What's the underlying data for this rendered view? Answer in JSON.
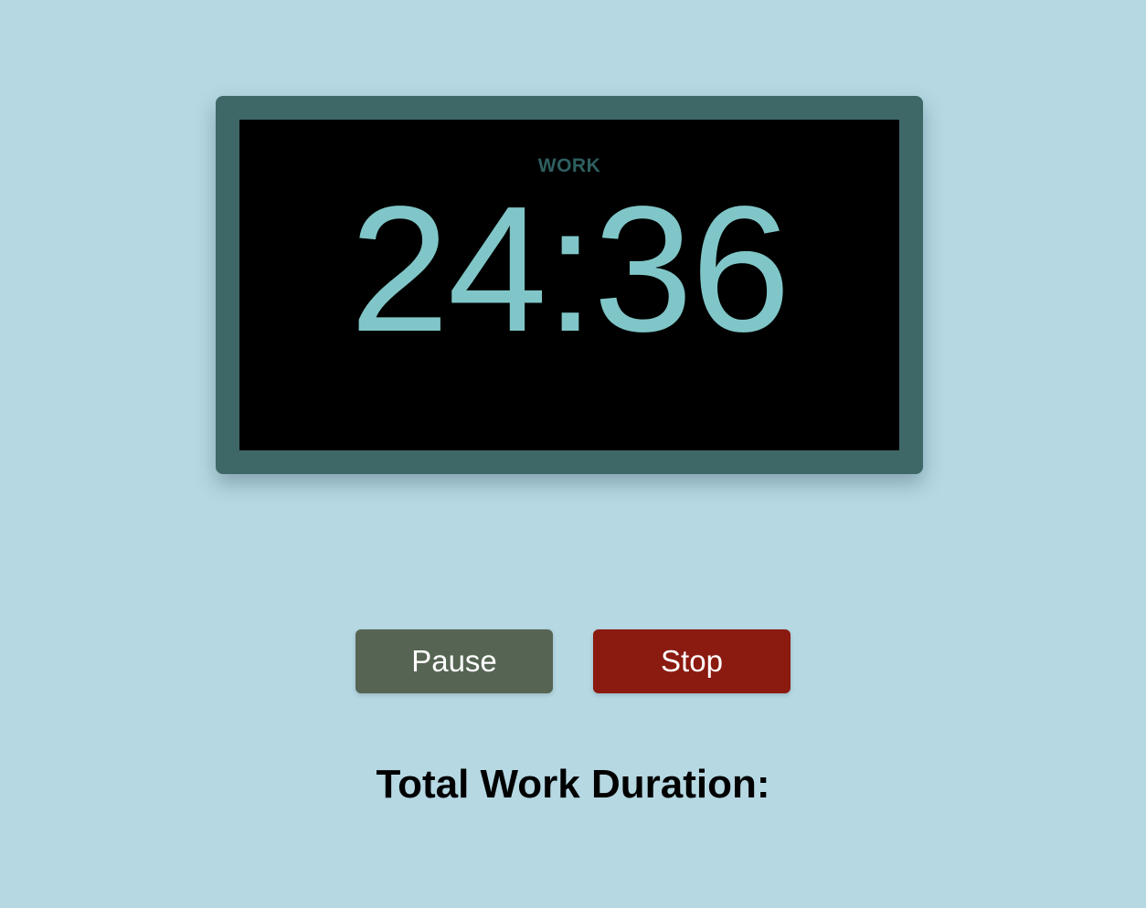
{
  "timer": {
    "mode_label": "WORK",
    "time": "24:36"
  },
  "controls": {
    "pause_label": "Pause",
    "stop_label": "Stop"
  },
  "summary": {
    "total_label": "Total Work Duration:"
  },
  "colors": {
    "background": "#b5d8e3",
    "frame": "#3e6867",
    "screen": "#000000",
    "time_text": "#80c6c8",
    "mode_text": "#2f5f60",
    "pause_button": "#566553",
    "stop_button": "#8b1a10"
  }
}
